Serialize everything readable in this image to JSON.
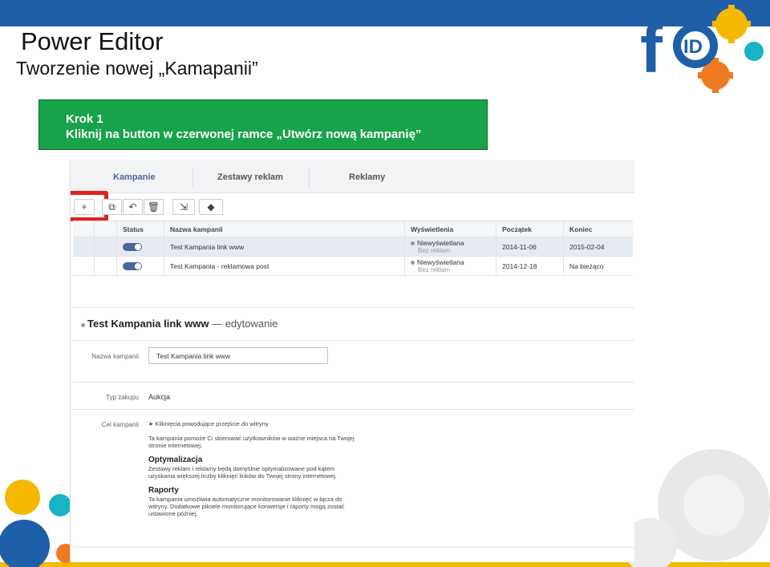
{
  "slide": {
    "title": "Power Editor",
    "subtitle": "Tworzenie nowej „Kamapanii”",
    "colors": {
      "topbar": "#1f5fa8",
      "step_box": "#18a34a",
      "highlight": "#e0241b",
      "accent": "#4b67a1"
    }
  },
  "step": {
    "line1": "Krok 1",
    "line2": "Kliknij na button w czerwonej ramce „Utwórz nową kampanię”"
  },
  "editor": {
    "tabs": [
      "Kampanie",
      "Zestawy reklam",
      "Reklamy"
    ],
    "toolbar": {
      "create_label": "+",
      "icons": [
        "duplicate-icon",
        "undo-icon",
        "trash-icon",
        "export-icon",
        "tag-icon"
      ]
    },
    "table": {
      "headers": [
        "Status",
        "Nazwa kampanii",
        "Wyświetlenia",
        "Początek",
        "Koniec"
      ],
      "rows": [
        {
          "name": "Test Kampania link www",
          "impressions": "Niewyświetlana",
          "impressions_sub": "Bez reklam",
          "start": "2014-11-06",
          "end": "2015-02-04"
        },
        {
          "name": "Test Kampania - reklamowa post",
          "impressions": "Niewyświetlana",
          "impressions_sub": "Bez reklam",
          "start": "2014-12-18",
          "end": "Na bieżąco"
        }
      ]
    },
    "detail": {
      "campaign_name": "Test Kampania link www",
      "editing_suffix": "— edytowanie",
      "name_label": "Nazwa kampanii",
      "name_value": "Test Kampania link www",
      "buy_type_label": "Typ zakupu",
      "buy_type_value": "Aukcja",
      "objective_label": "Cel kampanii",
      "objective_value": "Kliknięcia powodujące przejście do witryny",
      "objective_desc": "Ta kampania pomoże Ci skierować użytkowników w ważne miejsca na Twojej stronie internetowej.",
      "optimization_title": "Optymalizacja",
      "optimization_desc": "Zestawy reklam i reklamy będą domyślnie optymalizowane pod kątem uzyskania większej liczby kliknięć linków do Twojej strony internetowej.",
      "reports_title": "Raporty",
      "reports_desc": "Ta kampania umożliwia automatyczne monitorowanie kliknięć w łącza do witryny. Dodatkowe piksele monitorujące konwersje i raporty mogą zostać ustawione później."
    }
  }
}
